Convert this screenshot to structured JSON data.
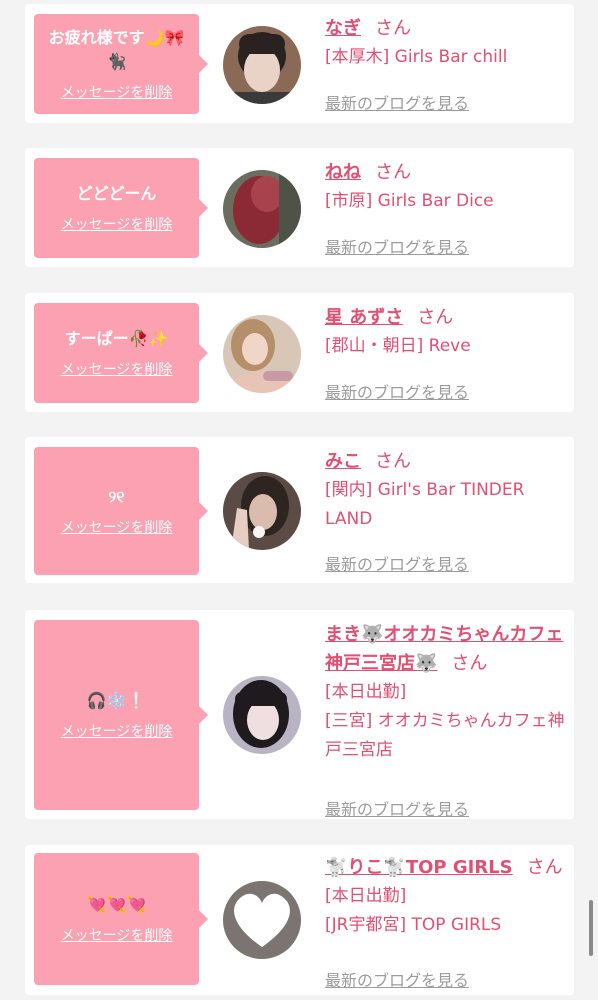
{
  "cards": [
    {
      "message": "お疲れ様です🌙🎀🐈‍⬛",
      "delete_label": "メッセージを削除",
      "name": "なぎ",
      "honorific": "さん",
      "lines": [
        "[本厚木] Girls Bar chill"
      ],
      "blog_label": "最新のブログを見る"
    },
    {
      "message": "どどどーん",
      "delete_label": "メッセージを削除",
      "name": "ねね",
      "honorific": "さん",
      "lines": [
        "[市原] Girls Bar Dice"
      ],
      "blog_label": "最新のブログを見る"
    },
    {
      "message": "すーぱー🥀✨",
      "delete_label": "メッセージを削除",
      "name": "星 あずさ",
      "honorific": "さん",
      "lines": [
        "[郡山・朝日] Reve"
      ],
      "blog_label": "最新のブログを見る"
    },
    {
      "message": "୨୧",
      "delete_label": "メッセージを削除",
      "name": "みこ",
      "honorific": "さん",
      "lines": [
        "[関内] Girl's Bar TINDER LAND"
      ],
      "blog_label": "最新のブログを見る"
    },
    {
      "message": "🎧❄️❕",
      "delete_label": "メッセージを削除",
      "name": "まき🐺オオカミちゃんカフェ神戸三宮店🐺",
      "honorific": "さん",
      "lines": [
        "[本日出勤]",
        "[三宮] オオカミちゃんカフェ神戸三宮店"
      ],
      "blog_label": "最新のブログを見る"
    },
    {
      "message": "💘💘💘",
      "delete_label": "メッセージを削除",
      "name": "🐩りこ🐩TOP GIRLS",
      "honorific": "さん",
      "lines": [
        "[本日出勤]",
        "[JR宇都宮] TOP GIRLS"
      ],
      "blog_label": "最新のブログを見る"
    }
  ]
}
